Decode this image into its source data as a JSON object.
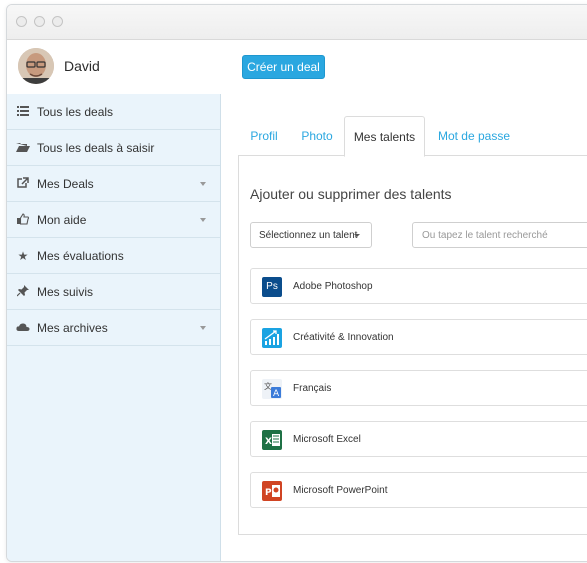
{
  "user": {
    "name": "David"
  },
  "header": {
    "create_deal_label": "Créer un deal"
  },
  "sidebar": {
    "items": [
      {
        "label": "Tous les deals",
        "icon": "list-icon",
        "has_caret": false
      },
      {
        "label": "Tous les deals à saisir",
        "icon": "folder-open-icon",
        "has_caret": false
      },
      {
        "label": "Mes Deals",
        "icon": "share-icon",
        "has_caret": true
      },
      {
        "label": "Mon aide",
        "icon": "thumbs-up-icon",
        "has_caret": true
      },
      {
        "label": "Mes évaluations",
        "icon": "star-icon",
        "has_caret": false
      },
      {
        "label": "Mes suivis",
        "icon": "pin-icon",
        "has_caret": false
      },
      {
        "label": "Mes archives",
        "icon": "cloud-icon",
        "has_caret": true
      }
    ]
  },
  "tabs": [
    {
      "label": "Profil"
    },
    {
      "label": "Photo"
    },
    {
      "label": "Mes talents"
    },
    {
      "label": "Mot de passe"
    }
  ],
  "active_tab": "Mes talents",
  "panel": {
    "title": "Ajouter ou supprimer des talents",
    "select_label": "Sélectionnez un talent",
    "search_placeholder": "Ou tapez le talent recherché"
  },
  "talents": [
    {
      "label": "Adobe Photoshop",
      "icon": "photoshop-icon",
      "icon_text": "Ps",
      "color": "#0b4d8c"
    },
    {
      "label": "Créativité & Innovation",
      "icon": "growth-chart-icon",
      "icon_text": "",
      "color": "#1aa3e2"
    },
    {
      "label": "Français",
      "icon": "translate-icon",
      "icon_text": "A",
      "color": "#3b7bd9"
    },
    {
      "label": "Microsoft Excel",
      "icon": "excel-icon",
      "icon_text": "X",
      "color": "#1e7145"
    },
    {
      "label": "Microsoft PowerPoint",
      "icon": "powerpoint-icon",
      "icon_text": "P",
      "color": "#d04423"
    }
  ],
  "colors": {
    "accent": "#2aa7e0",
    "sidebar_bg": "#eaf4fb"
  }
}
